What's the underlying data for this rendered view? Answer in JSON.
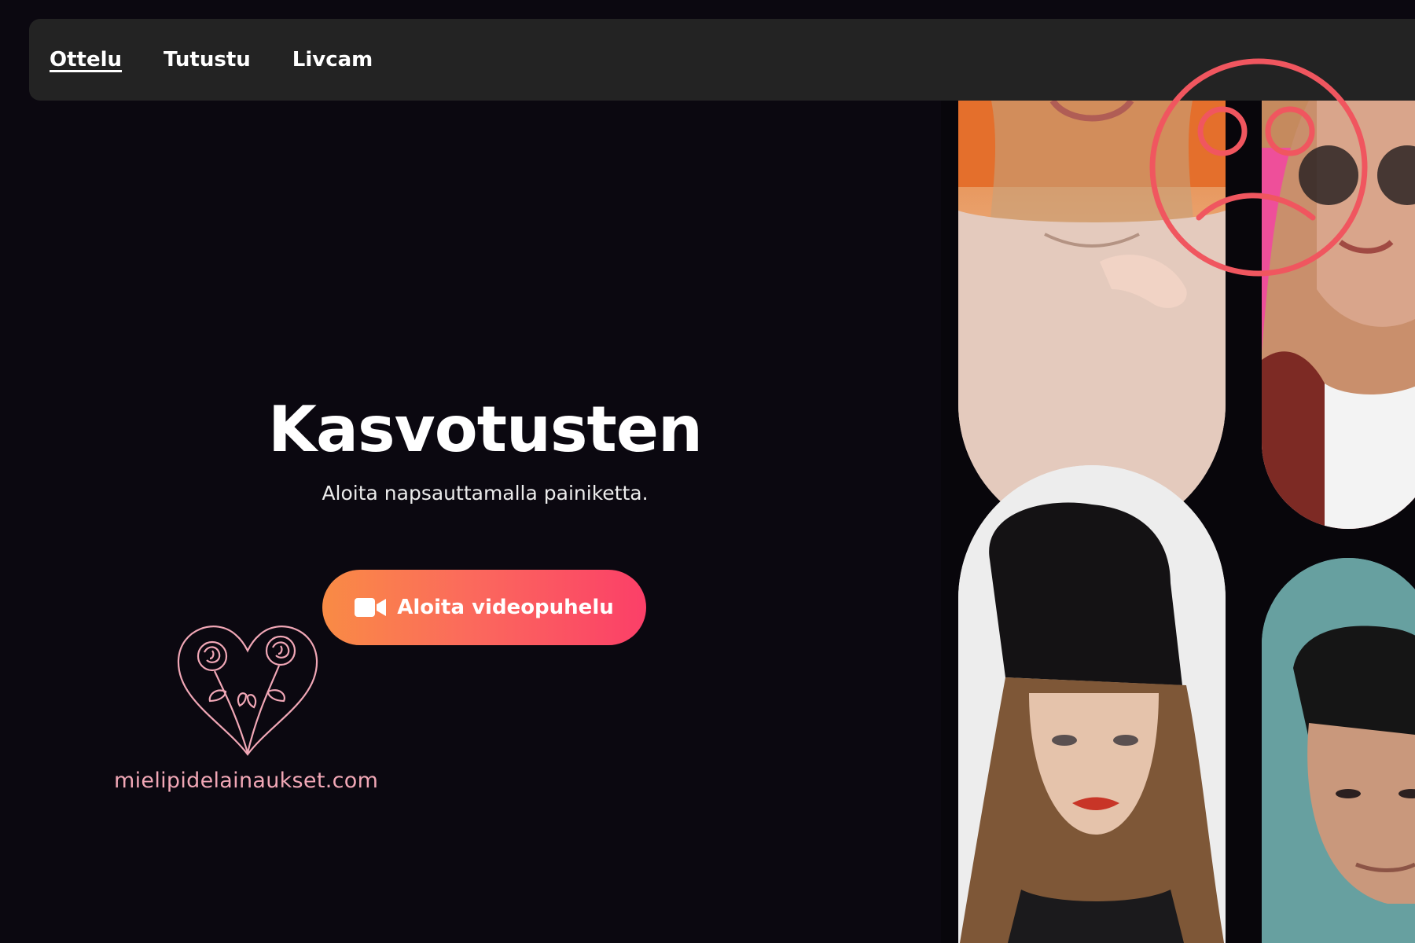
{
  "nav": {
    "items": [
      {
        "label": "Ottelu",
        "active": true
      },
      {
        "label": "Tutustu",
        "active": false
      },
      {
        "label": "Livcam",
        "active": false
      }
    ]
  },
  "hero": {
    "title": "Kasvotusten",
    "subtitle": "Aloita napsauttamalla painiketta.",
    "cta_label": "Aloita videopuhelu",
    "cta_icon": "video-camera-icon"
  },
  "watermark": {
    "text": "mielipidelainaukset.com",
    "logo_icon": "rose-heart-logo"
  },
  "overlay": {
    "icon": "sad-face-icon",
    "color": "#f0565f"
  },
  "gallery": {
    "tiles": [
      "profile-photo-woman-beige-top",
      "profile-photo-woman-sunglasses",
      "profile-photo-woman-black-beanie",
      "profile-photo-man-teal-background"
    ]
  },
  "colors": {
    "background": "#0b0810",
    "navbar": "#232323",
    "cta_gradient_start": "#f98b45",
    "cta_gradient_end": "#fb3f68",
    "watermark": "#f1a7b6"
  }
}
